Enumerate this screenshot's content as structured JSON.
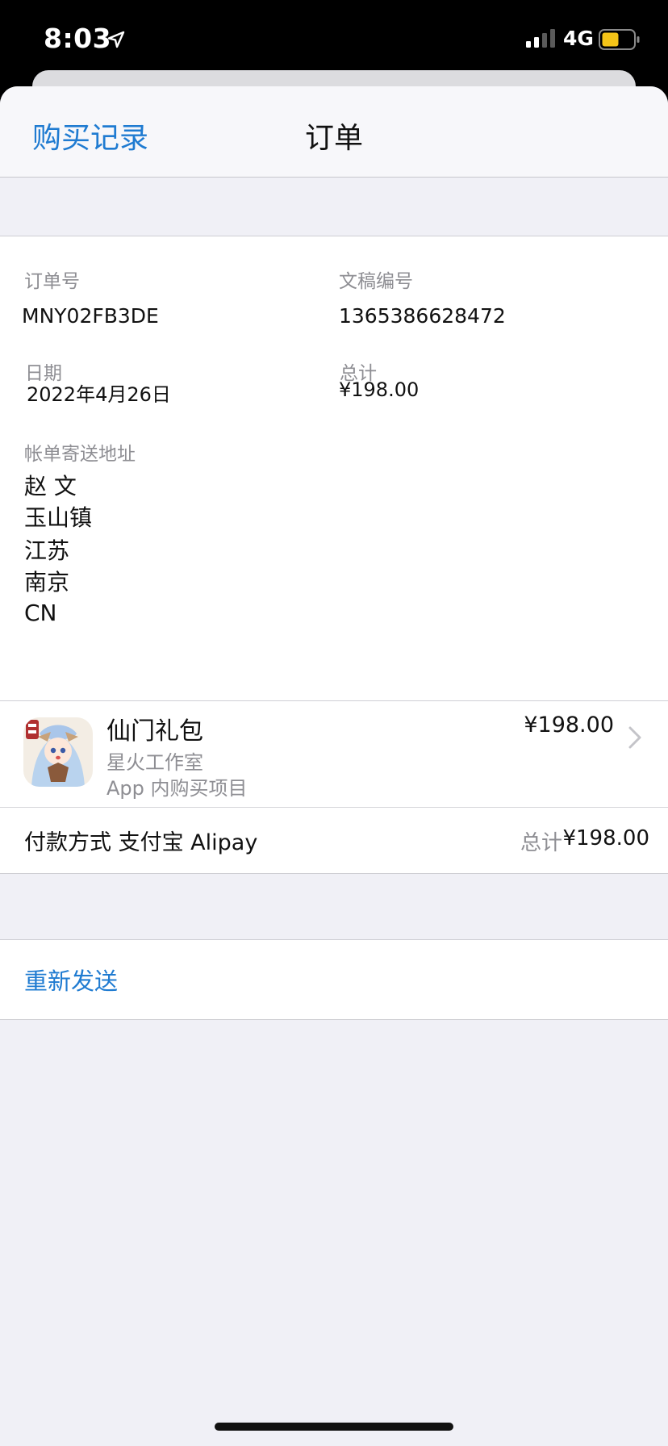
{
  "status_bar": {
    "time": "8:03",
    "network": "4G",
    "icons": [
      "location-arrow-icon",
      "signal-strength-icon",
      "battery-icon"
    ],
    "battery_color": "#f5c518"
  },
  "nav": {
    "back_label": "购买记录",
    "title": "订单"
  },
  "order_info": {
    "order_no_label": "订单号",
    "order_no": "MNY02FB3DE",
    "doc_no_label": "文稿编号",
    "doc_no": "1365386628472",
    "date_label": "日期",
    "date": "2022年4月26日",
    "total_label": "总计",
    "total": "¥198.00",
    "billing_label": "帐单寄送地址",
    "billing_address": [
      "赵 文",
      "玉山镇",
      "江苏",
      "南京",
      "CN"
    ]
  },
  "item": {
    "name": "仙门礼包",
    "developer": "星火工作室",
    "kind": "App 内购买项目",
    "price": "¥198.00"
  },
  "payment": {
    "label": "付款方式 支付宝 Alipay",
    "total_label": "总计",
    "total_value": "¥198.00"
  },
  "actions": {
    "resend_label": "重新发送"
  },
  "colors": {
    "accent": "#1f7bd1",
    "secondary_text": "#8e8e93",
    "background": "#f0f0f6"
  }
}
